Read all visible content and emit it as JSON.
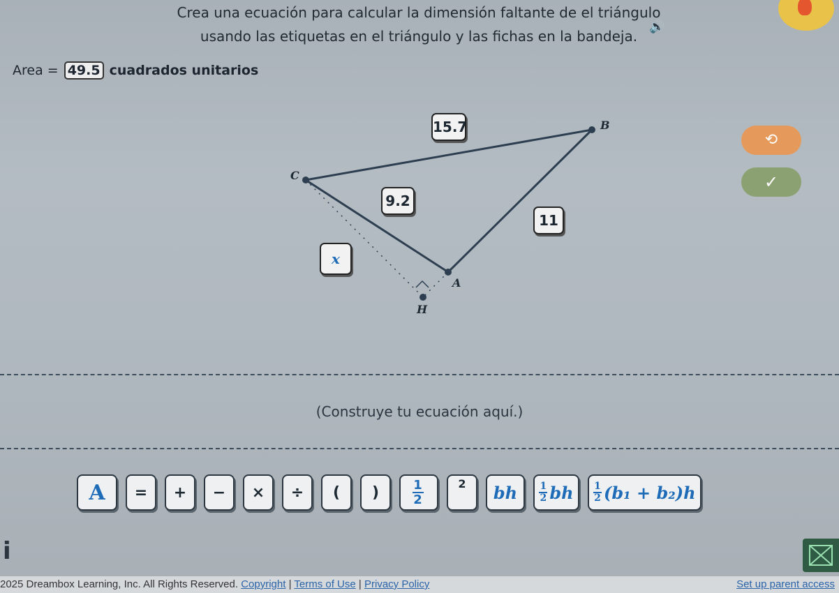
{
  "prompt": {
    "line1": "Crea una ecuación para calcular la dimensión faltante de el triángulo",
    "line2": "usando las etiquetas en el triángulo y las fichas en la bandeja."
  },
  "area": {
    "label": "Area =",
    "value": "49.5",
    "units": "cuadrados unitarios"
  },
  "triangle": {
    "vertices": {
      "B": "B",
      "C": "C",
      "A": "A",
      "H": "H"
    },
    "labels": {
      "top_side": "15.7",
      "left_side": "9.2",
      "right_side": "11",
      "height": "x"
    }
  },
  "buttons": {
    "undo": "⟲",
    "check": "✓"
  },
  "equation_area": {
    "placeholder": "(Construye tu ecuación aquí.)"
  },
  "tray": {
    "tiles": [
      "A",
      "=",
      "+",
      "−",
      "×",
      "÷",
      "(",
      ")",
      "½",
      "²",
      "bh",
      "½bh",
      "½(b₁ + b₂)h"
    ],
    "frac_numerator": "1",
    "frac_denominator": "2",
    "square_exponent": "2",
    "bh": "bh",
    "trap_tail": "(b₁ + b₂)h"
  },
  "footer": {
    "copyright": "2025 Dreambox Learning, Inc. All Rights Reserved.",
    "copyright_link": "Copyright",
    "terms": "Terms of Use",
    "privacy": "Privacy Policy",
    "separator": "|",
    "parent": "Set up parent access"
  },
  "colors": {
    "accent_blue": "#1e6bb8",
    "undo_orange": "#e59a5b",
    "check_green": "#8ca172"
  }
}
